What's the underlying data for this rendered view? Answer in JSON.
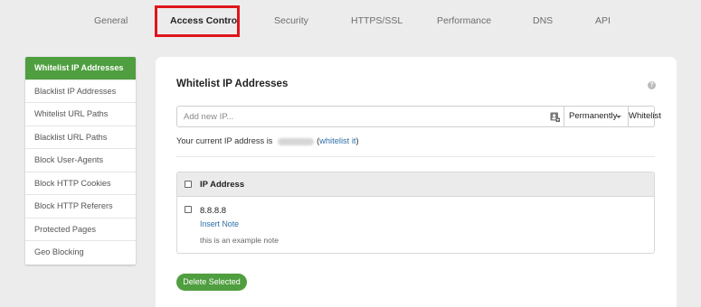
{
  "tabs": [
    {
      "label": "General"
    },
    {
      "label": "Access Control"
    },
    {
      "label": "Security"
    },
    {
      "label": "HTTPS/SSL"
    },
    {
      "label": "Performance"
    },
    {
      "label": "DNS"
    },
    {
      "label": "API"
    }
  ],
  "sidebar": {
    "items": [
      {
        "label": "Whitelist IP Addresses"
      },
      {
        "label": "Blacklist IP Addresses"
      },
      {
        "label": "Whitelist URL Paths"
      },
      {
        "label": "Blacklist URL Paths"
      },
      {
        "label": "Block User-Agents"
      },
      {
        "label": "Block HTTP Cookies"
      },
      {
        "label": "Block HTTP Referers"
      },
      {
        "label": "Protected Pages"
      },
      {
        "label": "Geo Blocking"
      }
    ]
  },
  "main": {
    "title": "Whitelist IP Addresses",
    "help": "?",
    "add_input": {
      "placeholder": "Add new IP...",
      "value": ""
    },
    "duration": "Permanently",
    "whitelist_label": "Whitelist",
    "current_ip_prefix": "Your current IP address is",
    "current_ip_link": "whitelist it",
    "paren_open": "(",
    "paren_close": ")",
    "table": {
      "header": "IP Address",
      "rows": [
        {
          "ip": "8.8.8.8",
          "action": "Insert Note",
          "note": "this is an example note"
        }
      ]
    },
    "delete_label": "Delete Selected"
  },
  "colors": {
    "accent": "#4f9e3f",
    "highlight": "#e0151d",
    "link": "#2d6fa6"
  },
  "icons": {
    "help": "help-icon",
    "contacts": "contacts-icon",
    "caret": "chevron-down-icon"
  }
}
